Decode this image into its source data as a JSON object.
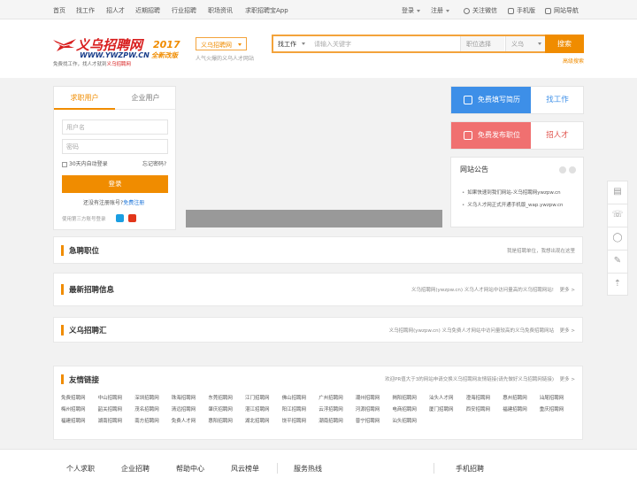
{
  "topbar": {
    "nav": [
      "首页",
      "找工作",
      "招人才",
      "近期招聘",
      "行业招聘",
      "职场资讯",
      "求职招聘宝App"
    ],
    "login": "登录",
    "register": "注册",
    "wechat": "关注微信",
    "mobile": "手机版",
    "sitenav": "网站导航"
  },
  "header": {
    "logo_text": "义乌招聘网",
    "logo_url": "WWW.YWZPW.CN",
    "slogan_prefix": "免费找工作，找人才就到",
    "slogan_highlight": "义乌招聘网",
    "slogan_suffix": "",
    "badge_year": "2017",
    "badge_version": "全新改版",
    "site_select": "义乌招聘网",
    "site_tagline": "人气火爆的义乌人才网站"
  },
  "search": {
    "type_label": "找工作",
    "placeholder": "请输入关键字",
    "job_select": "职位选择",
    "location": "义乌",
    "button": "搜索",
    "advanced": "高级搜索"
  },
  "login": {
    "tab_seeker": "求职用户",
    "tab_company": "企业用户",
    "username_placeholder": "用户名",
    "password_placeholder": "密码",
    "remember": "30天内自动登录",
    "forgot": "忘记密码?",
    "button": "登录",
    "no_account": "还没有注册账号?",
    "register_free": "免费注册",
    "third_party": "使用第三方账号登录"
  },
  "cards": {
    "resume_label": "免费填写简历",
    "resume_action": "找工作",
    "post_label": "免费发布职位",
    "post_action": "招人才"
  },
  "notice": {
    "title": "网站公告",
    "items": [
      "如果快速到我们网站-义乌招聘网ywzpw.cn",
      "义乌人才网正式开通手机版_wap.ywzpw.cn"
    ]
  },
  "sections": {
    "urgent_title": "急聘职位",
    "urgent_note": "我是招聘单位，我想出现在这里",
    "latest_title": "最新招聘信息",
    "latest_note": "义乌招聘网(ywzpw.cn) 义乌人才网站中访问量高的义乌招聘网站!",
    "latest_more": "更多 >",
    "hub_title": "义乌招聘汇",
    "hub_note": "义乌招聘网(ywzpw.cn) 义乌免费人才网站中访问量较高的义乌免费招聘网站",
    "hub_more": "更多 >"
  },
  "links": {
    "title": "友情链接",
    "note": "欢迎PR值大于3的网站申请交换义乌招聘网友情链接(请先做好义乌招聘网链接)",
    "more": "更多 >",
    "rows": [
      [
        "免费招聘网",
        "中山招聘网",
        "深圳招聘网",
        "珠海招聘网",
        "东莞招聘网",
        "江门招聘网",
        "佛山招聘网",
        "广州招聘网",
        "潮州招聘网",
        "揭阳招聘网",
        "汕头人才网",
        "澄海招聘网",
        "惠州招聘网",
        "汕尾招聘网"
      ],
      [
        "梅州招聘网",
        "韶关招聘网",
        "茂名招聘网",
        "清远招聘网",
        "肇庆招聘网",
        "湛江招聘网",
        "阳江招聘网",
        "云浮招聘网",
        "河源招聘网",
        "电商招聘网",
        "厦门招聘网",
        "西安招聘网",
        "福建招聘网",
        "重庆招聘网"
      ],
      [
        "福建招聘网",
        "湖南招聘网",
        "南方招聘网",
        "免费人才网",
        "惠阳招聘网",
        "湖北招聘网",
        "饶平招聘网",
        "潮南招聘网",
        "普宁招聘网",
        "汕头招聘网"
      ]
    ]
  },
  "footer": {
    "items": [
      "个人求职",
      "企业招聘",
      "帮助中心",
      "风云榜单",
      "服务热线",
      "手机招聘"
    ]
  },
  "side_float": [
    "resume-icon",
    "phone-icon",
    "qq-icon",
    "feedback-icon",
    "top-icon"
  ]
}
